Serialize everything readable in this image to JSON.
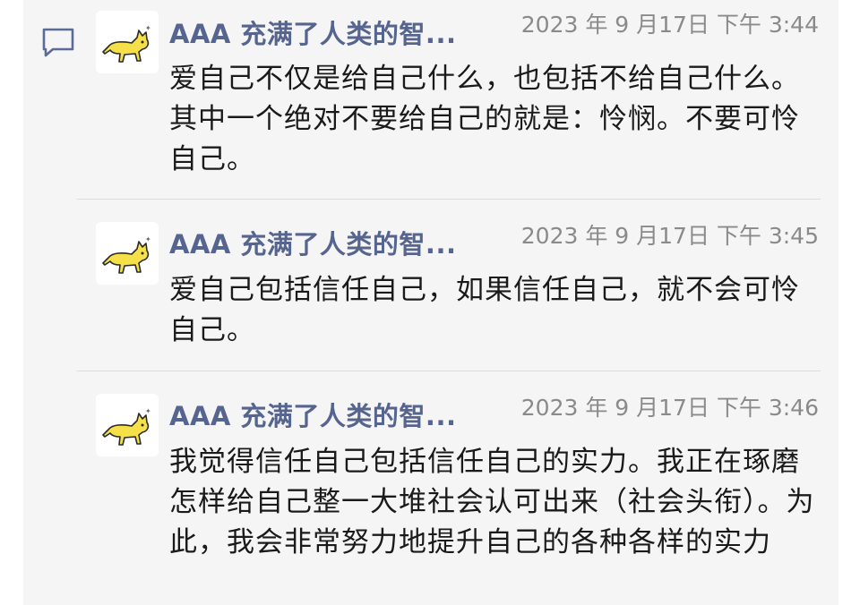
{
  "comments": [
    {
      "author": "AAA 充满了人类的智...",
      "time": "2023 年 9 月17日 下午 3:44",
      "text": "爱自己不仅是给自己什么，也包括不给自己什么。其中一个绝对不要给自己的就是：怜悯。不要可怜自己。"
    },
    {
      "author": "AAA 充满了人类的智...",
      "time": "2023 年 9 月17日 下午 3:45",
      "text": "爱自己包括信任自己，如果信任自己，就不会可怜自己。"
    },
    {
      "author": "AAA 充满了人类的智...",
      "time": "2023 年 9 月17日 下午 3:46",
      "text": "我觉得信任自己包括信任自己的实力。我正在琢磨怎样给自己整一大堆社会认可出来（社会头衔）。为此，我会非常努力地提升自己的各种各样的实力"
    }
  ],
  "icons": {
    "section": "comment-bubble-icon",
    "avatar": "yellow-cat-avatar"
  },
  "colors": {
    "author": "#56658f",
    "time": "#8a8a8a",
    "text": "#1a1a1a",
    "panel": "#f5f5f5",
    "icon": "#5a6b9a"
  }
}
